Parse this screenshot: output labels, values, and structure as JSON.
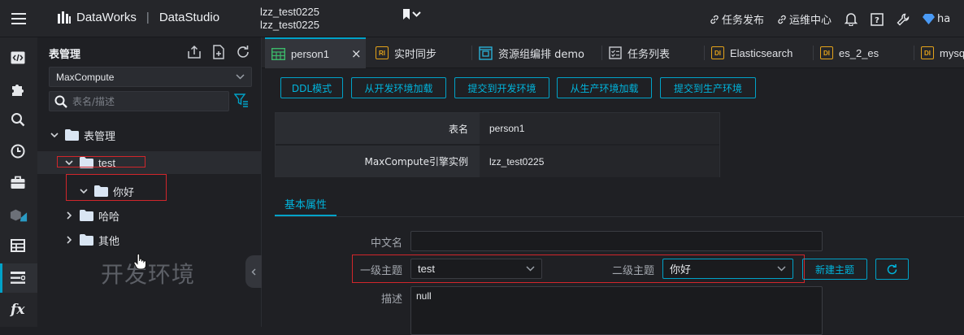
{
  "header": {
    "brand": "DataWorks",
    "module": "DataStudio",
    "project_line1": "lzz_test0225",
    "project_line2": "lzz_test0225",
    "links": [
      "任务发布",
      "运维中心"
    ],
    "user_initials": "ha"
  },
  "sidebar": {
    "title": "表管理",
    "engine_select": "MaxCompute",
    "search_placeholder": "表名/描述",
    "tree": [
      {
        "label": "表管理",
        "level": 0,
        "expanded": true
      },
      {
        "label": "test",
        "level": 1,
        "expanded": true,
        "selected": true
      },
      {
        "label": "你好",
        "level": 2,
        "expanded": true
      },
      {
        "label": "哈哈",
        "level": 1,
        "expanded": false
      },
      {
        "label": "其他",
        "level": 1,
        "expanded": false
      }
    ],
    "watermark": "开发环境"
  },
  "tabs": [
    {
      "label": "person1",
      "icon": "table-icon",
      "active": true,
      "close": "×"
    },
    {
      "label": "实时同步",
      "icon": "RI"
    },
    {
      "label": "资源组编排 demo",
      "icon": "resource-icon"
    },
    {
      "label": "任务列表",
      "icon": "checklist-icon"
    },
    {
      "label": "Elasticsearch",
      "icon": "DI"
    },
    {
      "label": "es_2_es",
      "icon": "DI"
    },
    {
      "label": "mysq",
      "icon": "DI"
    }
  ],
  "actions": [
    "DDL模式",
    "从开发环境加载",
    "提交到开发环境",
    "从生产环境加载",
    "提交到生产环境"
  ],
  "info": {
    "rows": [
      {
        "label": "表名",
        "value": "person1"
      },
      {
        "label": "MaxCompute引擎实例",
        "value": "lzz_test0225"
      }
    ]
  },
  "section_tab": "基本属性",
  "form": {
    "cn_name_label": "中文名",
    "cn_name_value": "",
    "level1_label": "一级主题",
    "level1_value": "test",
    "level2_label": "二级主题",
    "level2_value": "你好",
    "new_topic_button": "新建主题",
    "desc_label": "描述",
    "desc_value": "null"
  },
  "colors": {
    "accent": "#00a2c8",
    "highlight": "#d1262b",
    "background": "#1f2024"
  }
}
